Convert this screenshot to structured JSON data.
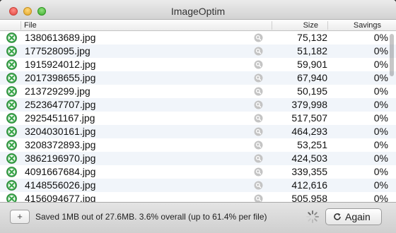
{
  "window": {
    "title": "ImageOptim"
  },
  "table": {
    "columns": {
      "file": "File",
      "size": "Size",
      "savings": "Savings"
    },
    "rows": [
      {
        "file": "1380613689.jpg",
        "size": "75,132",
        "savings": "0%",
        "status_icon": "x-circle-icon"
      },
      {
        "file": "177528095.jpg",
        "size": "51,182",
        "savings": "0%",
        "status_icon": "x-circle-icon"
      },
      {
        "file": "1915924012.jpg",
        "size": "59,901",
        "savings": "0%",
        "status_icon": "x-circle-icon"
      },
      {
        "file": "2017398655.jpg",
        "size": "67,940",
        "savings": "0%",
        "status_icon": "x-circle-icon"
      },
      {
        "file": "213729299.jpg",
        "size": "50,195",
        "savings": "0%",
        "status_icon": "x-circle-icon"
      },
      {
        "file": "2523647707.jpg",
        "size": "379,998",
        "savings": "0%",
        "status_icon": "x-circle-icon"
      },
      {
        "file": "2925451167.jpg",
        "size": "517,507",
        "savings": "0%",
        "status_icon": "x-circle-icon"
      },
      {
        "file": "3204030161.jpg",
        "size": "464,293",
        "savings": "0%",
        "status_icon": "x-circle-icon"
      },
      {
        "file": "3208372893.jpg",
        "size": "53,251",
        "savings": "0%",
        "status_icon": "x-circle-icon"
      },
      {
        "file": "3862196970.jpg",
        "size": "424,503",
        "savings": "0%",
        "status_icon": "x-circle-icon"
      },
      {
        "file": "4091667684.jpg",
        "size": "339,355",
        "savings": "0%",
        "status_icon": "x-circle-icon"
      },
      {
        "file": "4148556026.jpg",
        "size": "412,616",
        "savings": "0%",
        "status_icon": "x-circle-icon"
      },
      {
        "file": "4156094677.jpg",
        "size": "505,958",
        "savings": "0%",
        "status_icon": "x-circle-icon"
      }
    ]
  },
  "footer": {
    "add_label": "+",
    "status": "Saved 1MB out of 27.6MB. 3.6% overall (up to 61.4% per file)",
    "again_label": "Again"
  },
  "colors": {
    "status_green": "#3aa64a",
    "row_alt": "#f1f5fa"
  }
}
